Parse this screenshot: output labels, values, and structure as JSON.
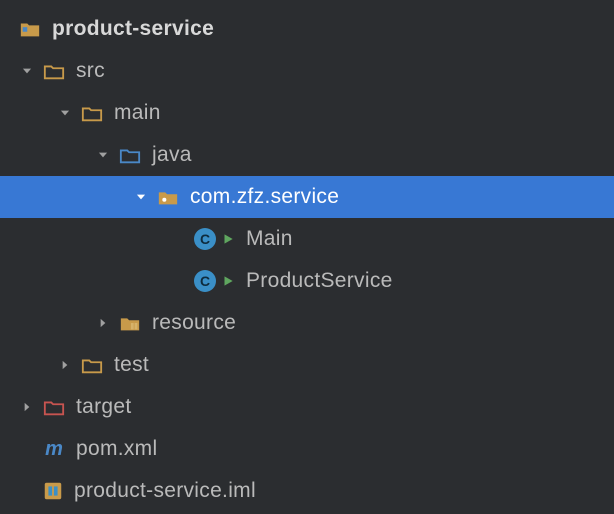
{
  "project": {
    "name": "product-service",
    "children": [
      {
        "name": "src",
        "expanded": true,
        "children": [
          {
            "name": "main",
            "expanded": true,
            "children": [
              {
                "name": "java",
                "type": "source-folder",
                "expanded": true,
                "children": [
                  {
                    "name": "com.zfz.service",
                    "type": "package",
                    "expanded": true,
                    "selected": true,
                    "children": [
                      {
                        "name": "Main",
                        "type": "class-runnable"
                      },
                      {
                        "name": "ProductService",
                        "type": "class-runnable"
                      }
                    ]
                  }
                ]
              },
              {
                "name": "resource",
                "type": "resource-folder",
                "expanded": false
              }
            ]
          },
          {
            "name": "test",
            "expanded": false
          }
        ]
      },
      {
        "name": "target",
        "type": "excluded-folder",
        "expanded": false
      },
      {
        "name": "pom.xml",
        "type": "maven"
      },
      {
        "name": "product-service.iml",
        "type": "iml"
      }
    ]
  }
}
